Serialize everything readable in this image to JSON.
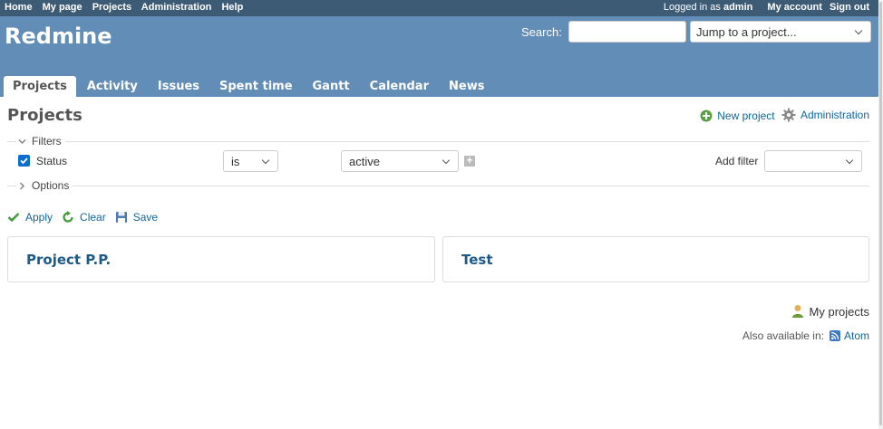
{
  "top_menu": {
    "items": [
      "Home",
      "My page",
      "Projects",
      "Administration",
      "Help"
    ],
    "logged_in_prefix": "Logged in as",
    "user": "admin",
    "my_account": "My account",
    "sign_out": "Sign out"
  },
  "header": {
    "title": "Redmine",
    "search_label": "Search:",
    "search_value": "",
    "jump_label": "Jump to a project..."
  },
  "tabs": [
    "Projects",
    "Activity",
    "Issues",
    "Spent time",
    "Gantt",
    "Calendar",
    "News"
  ],
  "content": {
    "title": "Projects",
    "contextual": {
      "new_project": "New project",
      "administration": "Administration"
    },
    "filters": {
      "legend": "Filters",
      "status_label": "Status",
      "status_checked": true,
      "operator": "is",
      "value": "active",
      "add_filter_label": "Add filter",
      "add_filter_value": ""
    },
    "options_legend": "Options",
    "buttons": {
      "apply": "Apply",
      "clear": "Clear",
      "save": "Save"
    },
    "projects": [
      "Project P.P.",
      "Test"
    ],
    "my_projects": "My projects",
    "also_available": "Also available in:",
    "atom": "Atom"
  },
  "colors": {
    "top_menu_bg": "#3e5b76",
    "header_bg": "#628db6",
    "link": "#116699"
  },
  "icons": {
    "new_project": "add-icon",
    "administration": "gear-icon",
    "apply": "checkmark-icon",
    "clear": "reload-icon",
    "save": "floppy-disk-icon",
    "my_projects": "user-icon",
    "atom": "feed-icon"
  }
}
